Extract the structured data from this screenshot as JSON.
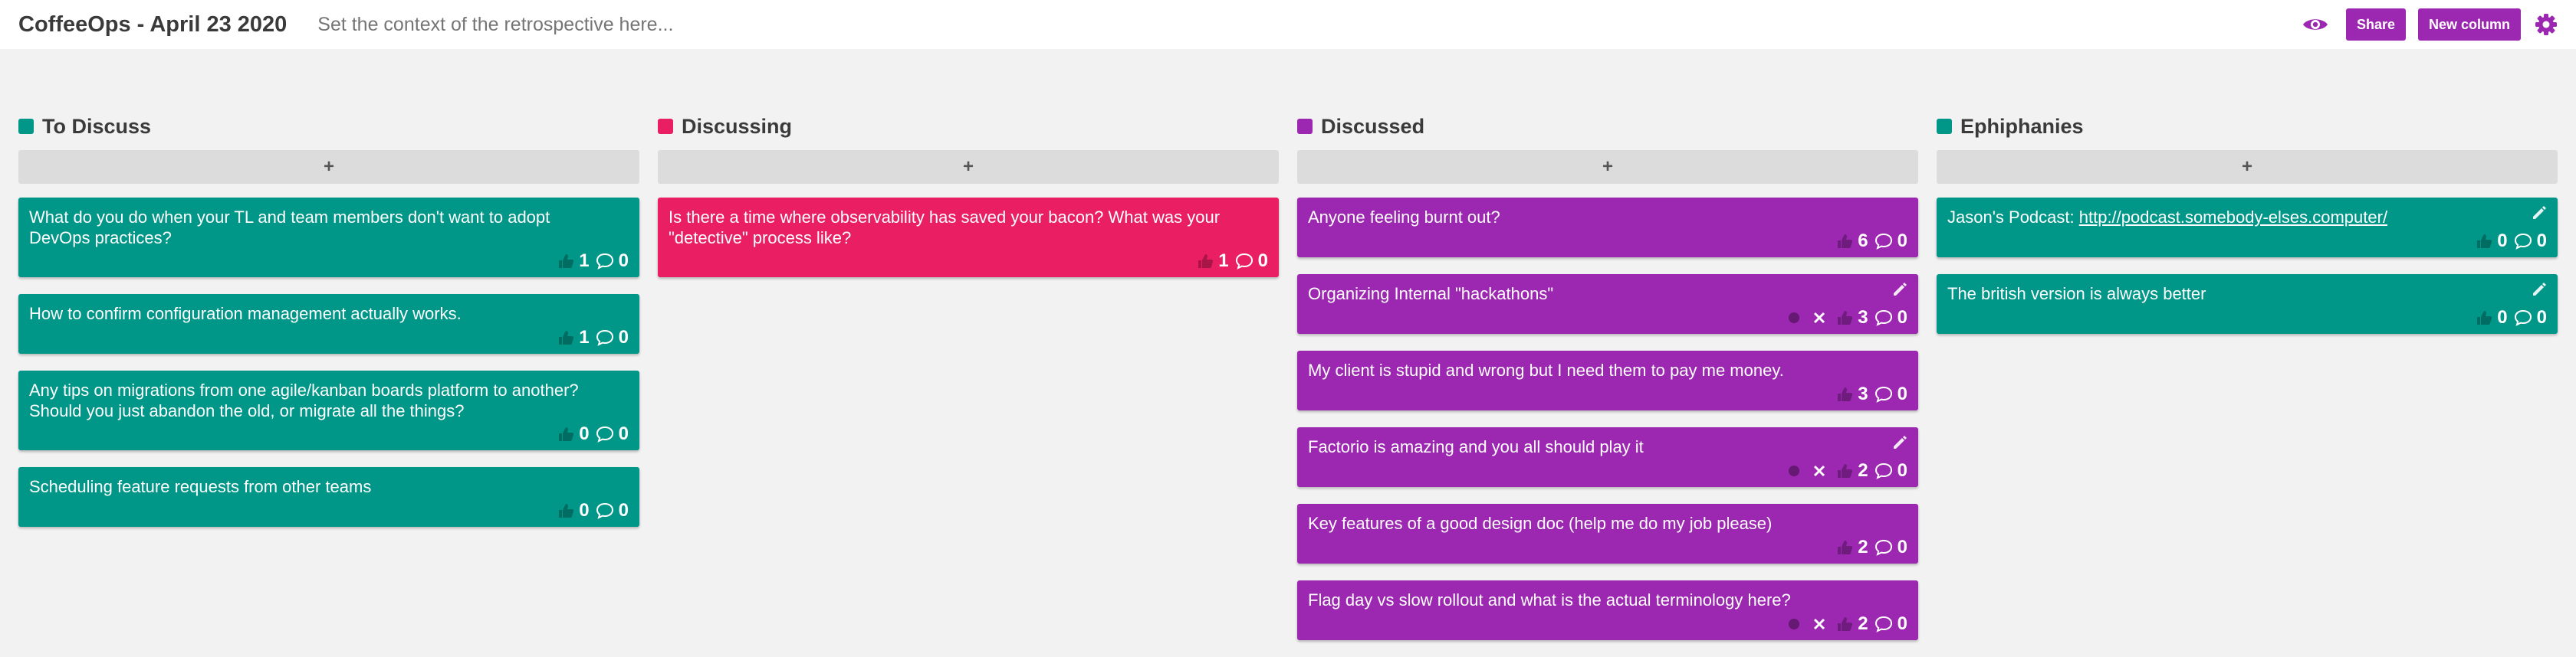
{
  "header": {
    "title": "CoffeeOps - April 23 2020",
    "context_placeholder": "Set the context of the retrospective here...",
    "share_label": "Share",
    "new_column_label": "New column",
    "accent_color": "#9c27b0"
  },
  "columns": [
    {
      "title": "To Discuss",
      "color": "#009688",
      "add_label": "+",
      "cards": [
        {
          "text": "What do you do when your TL and team members don't want to adopt DevOps practices?",
          "votes": "1",
          "comments": "0"
        },
        {
          "text": "How to confirm configuration management actually works.",
          "votes": "1",
          "comments": "0"
        },
        {
          "text": "Any tips on migrations from one agile/kanban boards platform to another? Should you just abandon the old, or migrate all the things?",
          "votes": "0",
          "comments": "0"
        },
        {
          "text": "Scheduling feature requests from other teams",
          "votes": "0",
          "comments": "0"
        }
      ]
    },
    {
      "title": "Discussing",
      "color": "#e91e63",
      "add_label": "+",
      "cards": [
        {
          "text": "Is there a time where observability has saved your bacon? What was your \"detective\" process like?",
          "votes": "1",
          "comments": "0"
        }
      ]
    },
    {
      "title": "Discussed",
      "color": "#9c27b0",
      "add_label": "+",
      "cards": [
        {
          "text": "Anyone feeling burnt out?",
          "votes": "6",
          "comments": "0"
        },
        {
          "text": "Organizing Internal \"hackathons\"",
          "votes": "3",
          "comments": "0"
        },
        {
          "text": "My client is stupid and wrong but I need them to pay me money.",
          "votes": "3",
          "comments": "0"
        },
        {
          "text": "Factorio is amazing and you all should play it",
          "votes": "2",
          "comments": "0"
        },
        {
          "text": "Key features of a good design doc (help me do my job please)",
          "votes": "2",
          "comments": "0"
        },
        {
          "text": "Flag day vs slow rollout and what is the actual terminology here?",
          "votes": "2",
          "comments": "0"
        }
      ]
    },
    {
      "title": "Ephiphanies",
      "color": "#009688",
      "add_label": "+",
      "cards": [
        {
          "text_prefix": "Jason's Podcast: ",
          "link": "http://podcast.somebody-elses.computer/",
          "votes": "0",
          "comments": "0"
        },
        {
          "text": "The british version is always better",
          "votes": "0",
          "comments": "0"
        }
      ]
    }
  ]
}
